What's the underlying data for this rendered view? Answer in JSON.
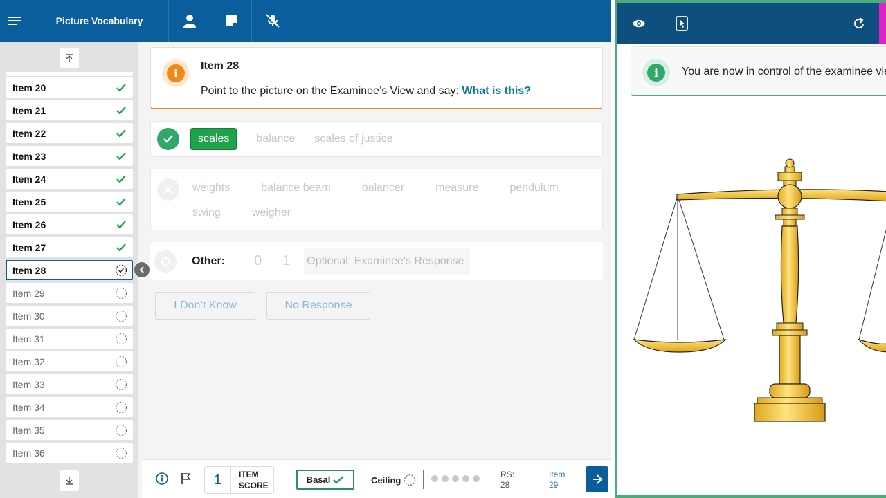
{
  "header": {
    "title": "Picture Vocabulary",
    "icons": [
      "menu-icon",
      "person-icon",
      "note-icon",
      "mic-off-icon"
    ]
  },
  "sidebar": {
    "items": [
      {
        "label": "Item 20",
        "state": "done"
      },
      {
        "label": "Item 21",
        "state": "done"
      },
      {
        "label": "Item 22",
        "state": "done"
      },
      {
        "label": "Item 23",
        "state": "done"
      },
      {
        "label": "Item 24",
        "state": "done"
      },
      {
        "label": "Item 25",
        "state": "done"
      },
      {
        "label": "Item 26",
        "state": "done"
      },
      {
        "label": "Item 27",
        "state": "done"
      },
      {
        "label": "Item 28",
        "state": "active"
      },
      {
        "label": "Item 29",
        "state": "todo"
      },
      {
        "label": "Item 30",
        "state": "todo"
      },
      {
        "label": "Item 31",
        "state": "todo"
      },
      {
        "label": "Item 32",
        "state": "todo"
      },
      {
        "label": "Item 33",
        "state": "todo"
      },
      {
        "label": "Item 34",
        "state": "todo"
      },
      {
        "label": "Item 35",
        "state": "todo"
      },
      {
        "label": "Item 36",
        "state": "todo"
      }
    ]
  },
  "prompt": {
    "item_title": "Item 28",
    "instruction": "Point to the picture on the Examinee’s View and say: ",
    "question": "What is this?"
  },
  "correct_responses": {
    "options": [
      "scales",
      "balance",
      "scales of justice"
    ],
    "selected": "scales"
  },
  "incorrect_responses": {
    "row1": [
      "weights",
      "balance beam",
      "balancer",
      "measure",
      "pendulum"
    ],
    "row2": [
      "swing",
      "weigher"
    ]
  },
  "other": {
    "label": "Other:",
    "score_options": [
      "0",
      "1"
    ],
    "placeholder": "Optional: Examinee's Response"
  },
  "actions": {
    "dont_know": "I Don’t Know",
    "no_response": "No Response"
  },
  "footer": {
    "item_score": "1",
    "item_score_label_1": "ITEM",
    "item_score_label_2": "SCORE",
    "basal": "Basal",
    "ceiling": "Ceiling",
    "rs_label": "RS:",
    "rs_value": "28",
    "next_label": "Item",
    "next_value": "29"
  },
  "examinee_view": {
    "notice": "You are now in control of the examinee view",
    "accent_color": "#4bab7a"
  },
  "colors": {
    "header": "#0a5e9c",
    "correct": "#1fa34a",
    "warning": "#f08a17"
  }
}
